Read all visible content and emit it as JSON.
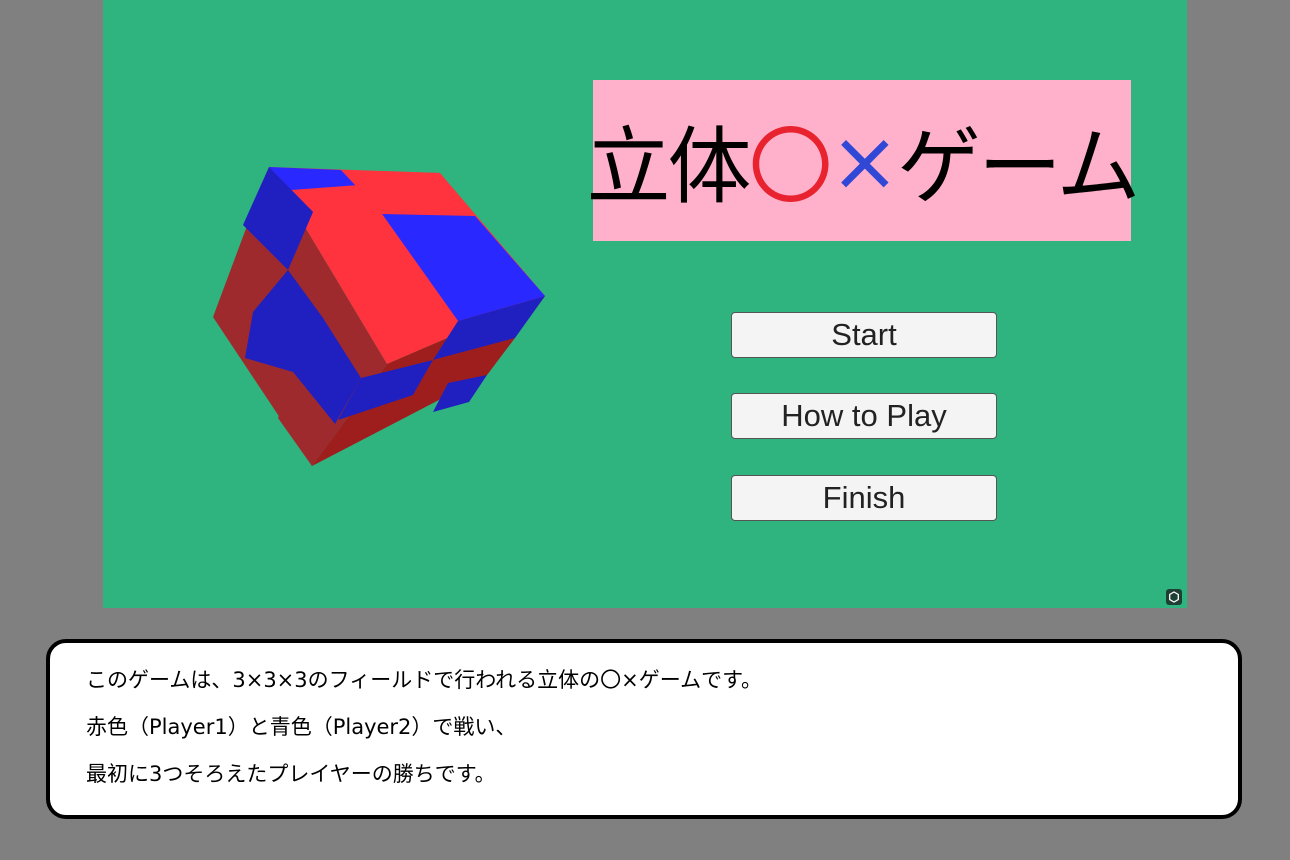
{
  "title": {
    "prefix": "立体",
    "circle": "〇",
    "cross": "×",
    "suffix": "ゲーム"
  },
  "menu": {
    "start": "Start",
    "how_to_play": "How to Play",
    "finish": "Finish"
  },
  "description": {
    "lines": [
      "このゲームは、3×3×3のフィールドで行われる立体の〇×ゲームです。",
      "赤色（Player1）と青色（Player2）で戦い、",
      "最初に3つそろえたプレイヤーの勝ちです。"
    ]
  },
  "colors": {
    "scene_background": "#2fb37f",
    "title_background": "#ffb0ca",
    "player1_red": "#ff333d",
    "player2_blue": "#2828ff",
    "outer_background": "#808080"
  },
  "icons": {
    "corner": "settings-icon"
  }
}
